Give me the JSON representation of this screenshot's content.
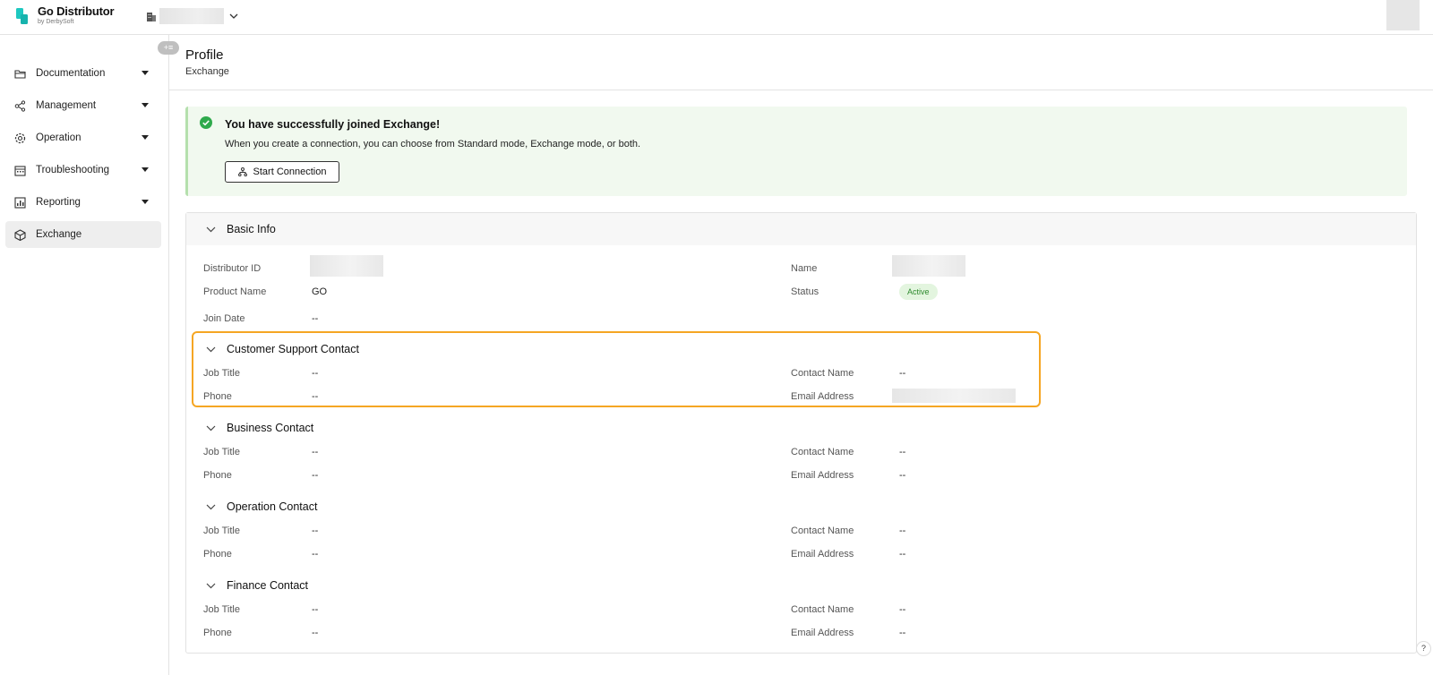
{
  "app": {
    "name": "Go Distributor",
    "byline": "by DerbySoft"
  },
  "sidebar": {
    "collapse_label": "+≡",
    "items": [
      {
        "label": "Documentation",
        "icon": "folder-icon"
      },
      {
        "label": "Management",
        "icon": "share-nodes-icon"
      },
      {
        "label": "Operation",
        "icon": "gear-icon"
      },
      {
        "label": "Troubleshooting",
        "icon": "calendar-icon"
      },
      {
        "label": "Reporting",
        "icon": "chart-icon"
      },
      {
        "label": "Exchange",
        "icon": "cube-icon",
        "active": true
      }
    ]
  },
  "page": {
    "title": "Profile",
    "subtitle": "Exchange"
  },
  "banner": {
    "title": "You have successfully joined Exchange!",
    "text": "When you create a connection, you can choose from Standard mode, Exchange mode, or both.",
    "button": "Start Connection"
  },
  "basic_info": {
    "title": "Basic Info",
    "distributor_id_label": "Distributor ID",
    "name_label": "Name",
    "product_name_label": "Product Name",
    "product_name": "GO",
    "status_label": "Status",
    "status": "Active",
    "join_date_label": "Join Date",
    "join_date": "--"
  },
  "contacts": [
    {
      "title": "Customer Support Contact",
      "job_title_label": "Job Title",
      "job_title": "--",
      "contact_name_label": "Contact Name",
      "contact_name": "--",
      "phone_label": "Phone",
      "phone": "--",
      "email_label": "Email Address",
      "email": ""
    },
    {
      "title": "Business Contact",
      "job_title_label": "Job Title",
      "job_title": "--",
      "contact_name_label": "Contact Name",
      "contact_name": "--",
      "phone_label": "Phone",
      "phone": "--",
      "email_label": "Email Address",
      "email": "--"
    },
    {
      "title": "Operation Contact",
      "job_title_label": "Job Title",
      "job_title": "--",
      "contact_name_label": "Contact Name",
      "contact_name": "--",
      "phone_label": "Phone",
      "phone": "--",
      "email_label": "Email Address",
      "email": "--"
    },
    {
      "title": "Finance Contact",
      "job_title_label": "Job Title",
      "job_title": "--",
      "contact_name_label": "Contact Name",
      "contact_name": "--",
      "phone_label": "Phone",
      "phone": "--",
      "email_label": "Email Address",
      "email": "--"
    }
  ],
  "help_label": "?",
  "colors": {
    "accent": "#1ec8c0",
    "success": "#2faa4c",
    "highlight": "#f5a623"
  }
}
